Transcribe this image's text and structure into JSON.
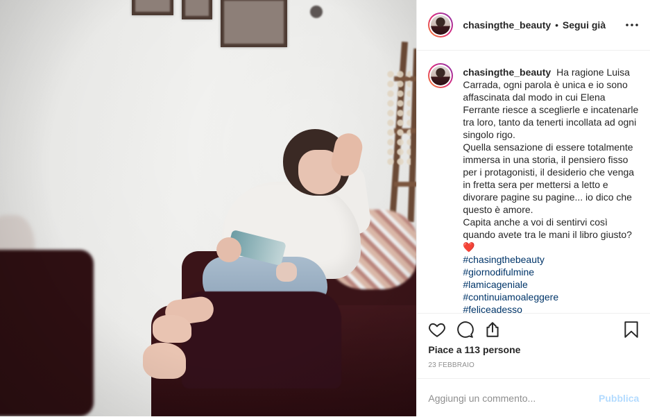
{
  "post": {
    "username": "chasingthe_beauty",
    "follow_separator": "•",
    "follow_status": "Segui già",
    "caption_text": "Ha ragione Luisa Carrada, ogni parola è unica e io sono affascinata dal modo in cui Elena Ferrante riesce a sceglierle e incatenarle tra loro, tanto da tenerti incollata ad ogni singolo rigo.\nQuella sensazione di essere totalmente immersa in una storia, il pensiero fisso per i protagonisti, il desiderio che venga in fretta sera per mettersi a letto e divorare pagine su pagine... io dico che questo è amore.\nCapita anche a voi di sentirvi così quando avete tra le mani il libro giusto?",
    "caption_emoji": "❤️",
    "hashtags": [
      "#chasingthebeauty",
      "#giornodifulmine",
      "#lamicageniale",
      "#continuiamoaleggere",
      "#feliceadesso"
    ],
    "likes_text": "Piace a 113 persone",
    "date": "23 FEBBRAIO",
    "comment_placeholder": "Aggiungi un commento...",
    "publish_label": "Pubblica"
  },
  "icons": {
    "more": "more-options-icon",
    "like": "heart-icon",
    "comment": "comment-icon",
    "share": "share-icon",
    "save": "bookmark-icon"
  },
  "colors": {
    "text": "#262626",
    "hashtag": "#003569",
    "muted": "#8e8e8e",
    "publish_disabled": "#b3dbff",
    "divider": "#efefef"
  }
}
